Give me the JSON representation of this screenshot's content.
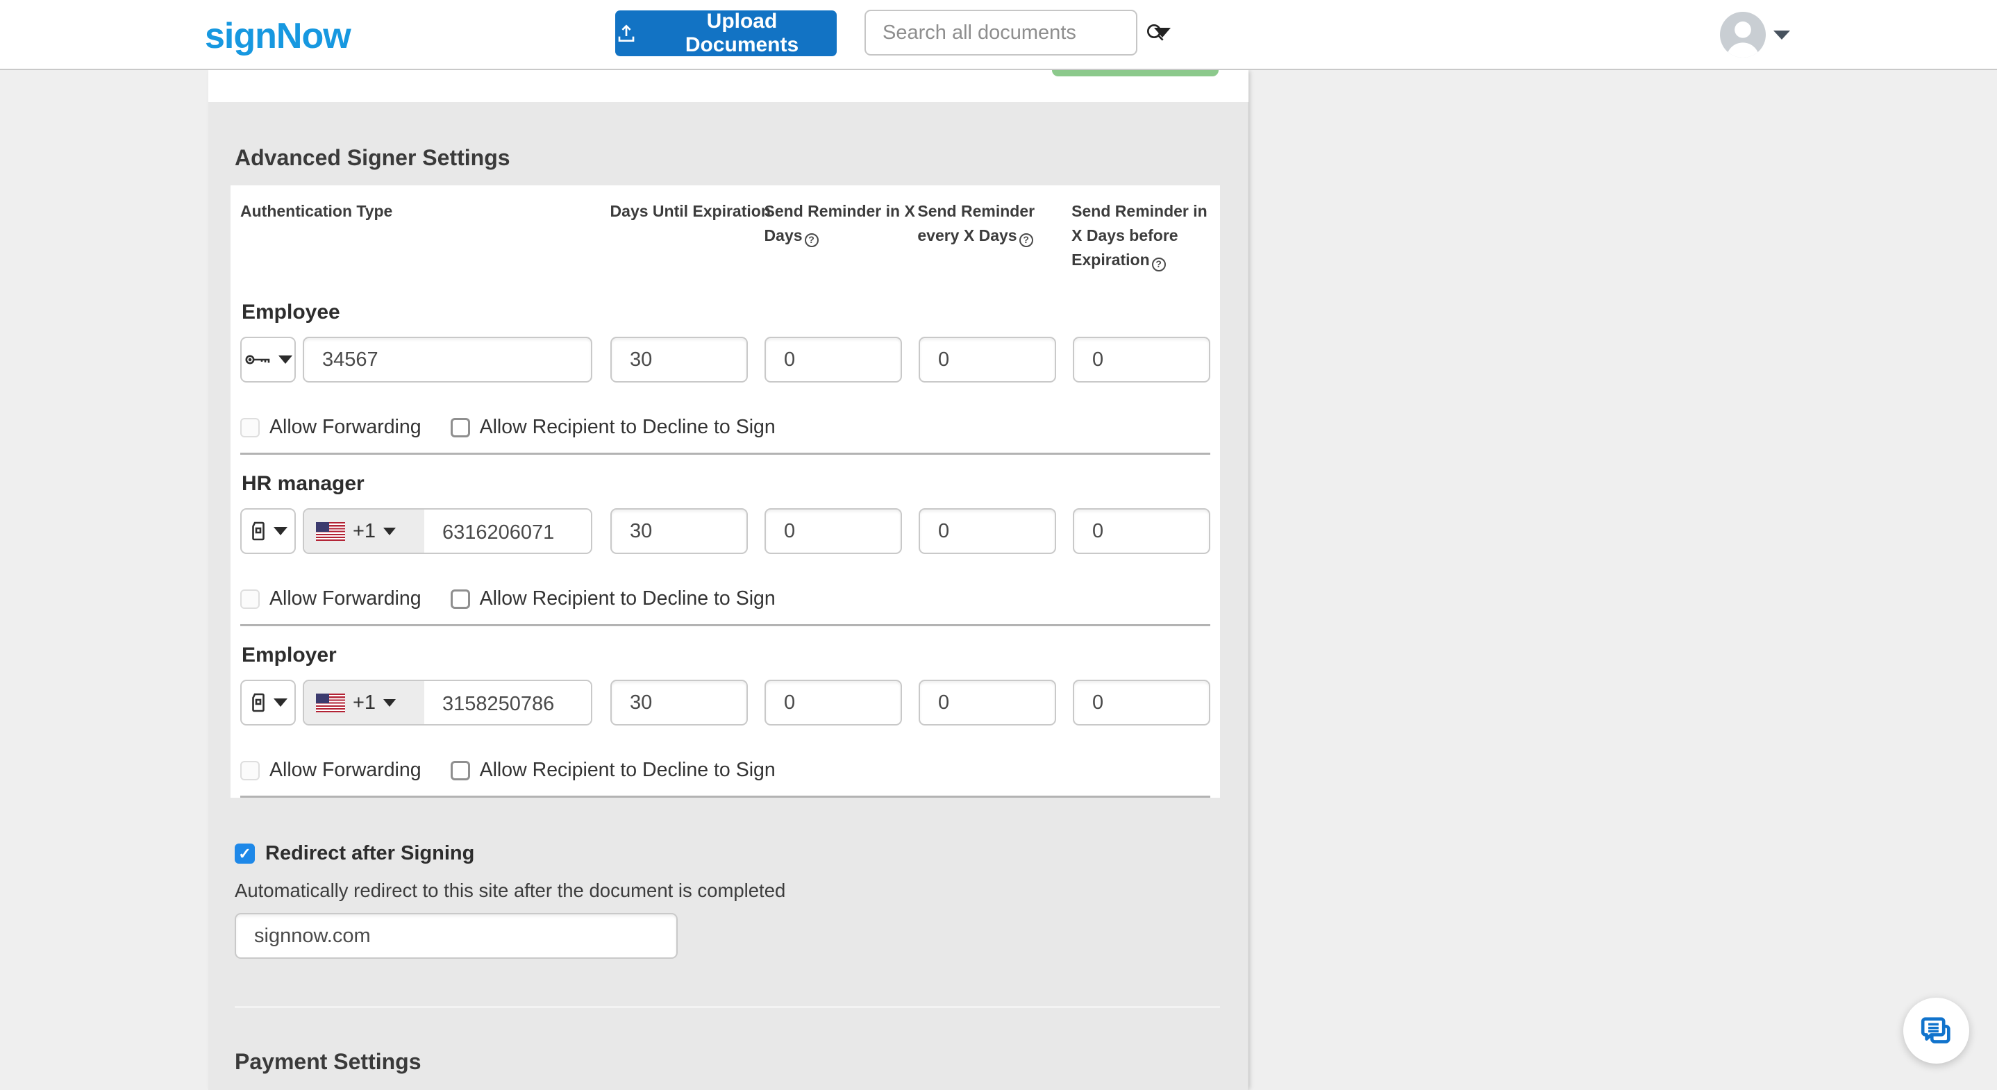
{
  "header": {
    "logo": "signNow",
    "upload_button": "Upload Documents",
    "search_placeholder": "Search all documents"
  },
  "settings": {
    "title": "Advanced Signer Settings",
    "columns": [
      "Authentication Type",
      "Days Until Expiration",
      "Send Reminder in X Days",
      "Send Reminder every X Days",
      "Send Reminder in X Days before Expiration"
    ],
    "checkbox_labels": {
      "forwarding": "Allow Forwarding",
      "decline": "Allow Recipient to Decline to Sign"
    },
    "signers": [
      {
        "name": "Employee",
        "auth": "password",
        "value": "34567",
        "expiration": "30",
        "reminder_in": "0",
        "reminder_every": "0",
        "reminder_before": "0",
        "allow_forwarding": false,
        "allow_decline": false
      },
      {
        "name": "HR manager",
        "auth": "phone",
        "country_code": "+1",
        "value": "6316206071",
        "expiration": "30",
        "reminder_in": "0",
        "reminder_every": "0",
        "reminder_before": "0",
        "allow_forwarding": false,
        "allow_decline": false
      },
      {
        "name": "Employer",
        "auth": "phone",
        "country_code": "+1",
        "value": "3158250786",
        "expiration": "30",
        "reminder_in": "0",
        "reminder_every": "0",
        "reminder_before": "0",
        "allow_forwarding": false,
        "allow_decline": false
      }
    ]
  },
  "redirect": {
    "label": "Redirect after Signing",
    "checked": true,
    "description": "Automatically redirect to this site after the document is completed",
    "url": "signnow.com"
  },
  "payment": {
    "title": "Payment Settings"
  },
  "colors": {
    "brand_blue": "#1798e0",
    "button_blue": "#1273c4",
    "accent_green": "#8cc98c",
    "checkbox_blue": "#1e88e8",
    "divider_gray": "#b3b3b3"
  }
}
